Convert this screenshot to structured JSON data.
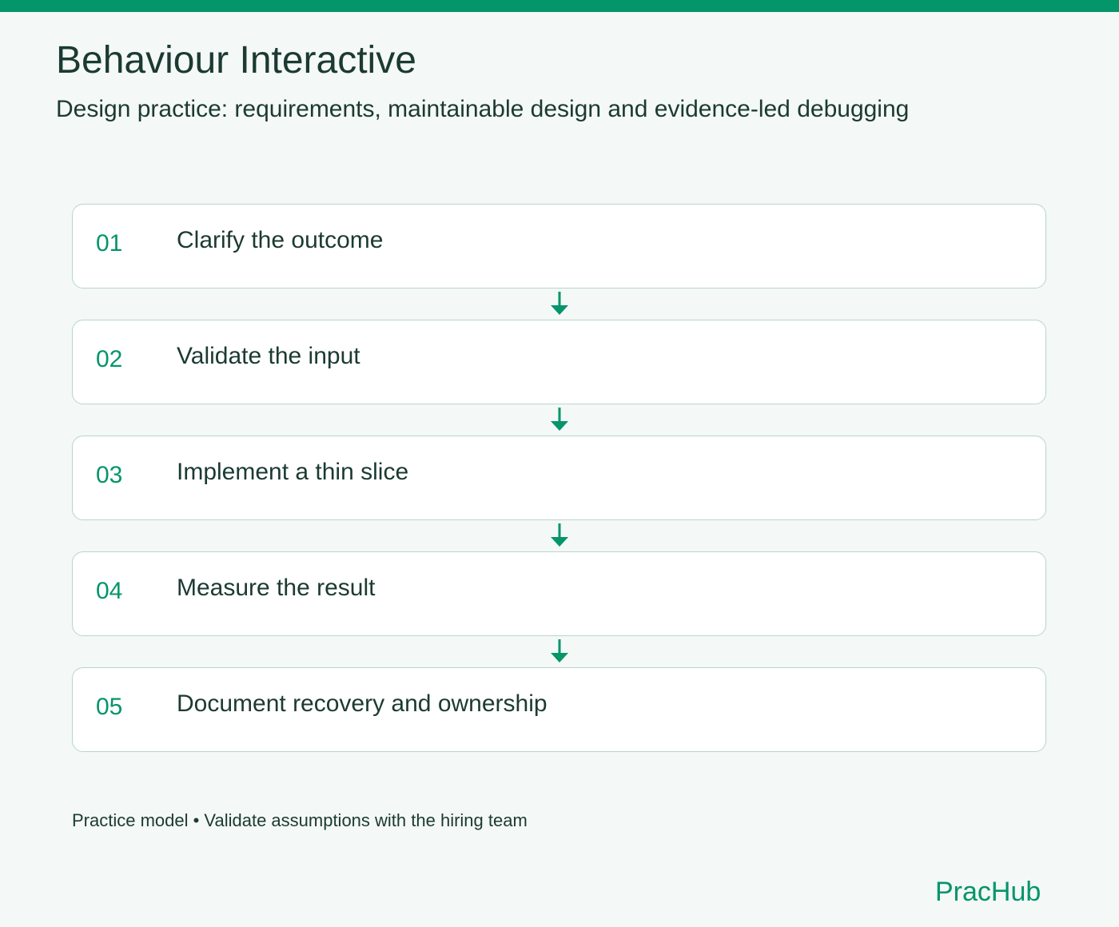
{
  "header": {
    "title": "Behaviour Interactive",
    "subtitle": "Design practice: requirements, maintainable design and evidence-led debugging"
  },
  "steps": [
    {
      "number": "01",
      "label": "Clarify the outcome"
    },
    {
      "number": "02",
      "label": "Validate the input"
    },
    {
      "number": "03",
      "label": "Implement a thin slice"
    },
    {
      "number": "04",
      "label": "Measure the result"
    },
    {
      "number": "05",
      "label": "Document recovery and ownership"
    }
  ],
  "footer": {
    "note": "Practice model • Validate assumptions with the hiring team",
    "brand": "PracHub"
  },
  "colors": {
    "accent": "#04956a",
    "text": "#1b3a32",
    "background": "#f4f8f6",
    "card_border": "#b8d6cc"
  }
}
